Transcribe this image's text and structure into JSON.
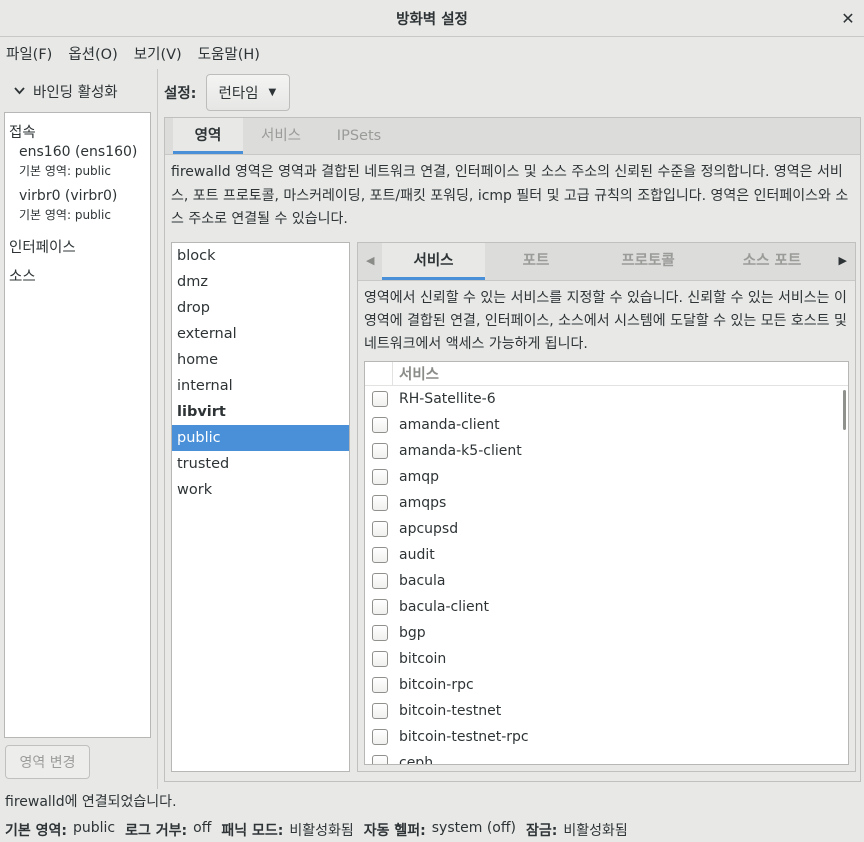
{
  "window": {
    "title": "방화벽 설정",
    "close_icon": "close-icon"
  },
  "menu": [
    "파일(F)",
    "옵션(O)",
    "보기(V)",
    "도움말(H)"
  ],
  "binding": {
    "label": "바인딩 활성화"
  },
  "connections": {
    "heading": "접속",
    "devices": [
      {
        "name": "ens160 (ens160)",
        "zone": "기본 영역: public"
      },
      {
        "name": "virbr0 (virbr0)",
        "zone": "기본 영역: public"
      }
    ],
    "interfaces_label": "인터페이스",
    "sources_label": "소스"
  },
  "change_zone_button": "영역 변경",
  "settings": {
    "label": "설정:",
    "value": "런타임"
  },
  "main_tabs": [
    "영역",
    "서비스",
    "IPSets"
  ],
  "zones_description": "firewalld 영역은 영역과 결합된 네트워크 연결, 인터페이스 및 소스 주소의 신뢰된 수준을 정의합니다. 영역은 서비스, 포트 프로토콜, 마스커레이딩, 포트/패킷 포워딩, icmp 필터 및 고급 규칙의 조합입니다. 영역은 인터페이스와 소스 주소로 연결될 수 있습니다.",
  "zones": [
    "block",
    "dmz",
    "drop",
    "external",
    "home",
    "internal",
    "libvirt",
    "public",
    "trusted",
    "work"
  ],
  "selected_zone": "public",
  "sub_tabs": [
    "서비스",
    "포트",
    "프로토콜",
    "소스 포트"
  ],
  "services_description": "영역에서 신뢰할 수 있는 서비스를 지정할 수 있습니다. 신뢰할 수 있는 서비스는 이 영역에 결합된 연결, 인터페이스, 소스에서 시스템에 도달할 수 있는 모든 호스트 및 네트워크에서 액세스 가능하게 됩니다.",
  "services_column": "서비스",
  "services": [
    "RH-Satellite-6",
    "amanda-client",
    "amanda-k5-client",
    "amqp",
    "amqps",
    "apcupsd",
    "audit",
    "bacula",
    "bacula-client",
    "bgp",
    "bitcoin",
    "bitcoin-rpc",
    "bitcoin-testnet",
    "bitcoin-testnet-rpc",
    "ceph"
  ],
  "status_message": "firewalld에 연결되었습니다.",
  "status_bar": {
    "default_zone_label": "기본 영역:",
    "default_zone": "public",
    "log_denied_label": "로그 거부:",
    "log_denied": "off",
    "panic_label": "패닉 모드:",
    "panic": "비활성화됨",
    "helper_label": "자동 헬퍼:",
    "helper": "system (off)",
    "lockdown_label": "잠금:",
    "lockdown": "비활성화됨"
  },
  "colors": {
    "accent": "#4a90d9",
    "background": "#e8e8e7"
  }
}
